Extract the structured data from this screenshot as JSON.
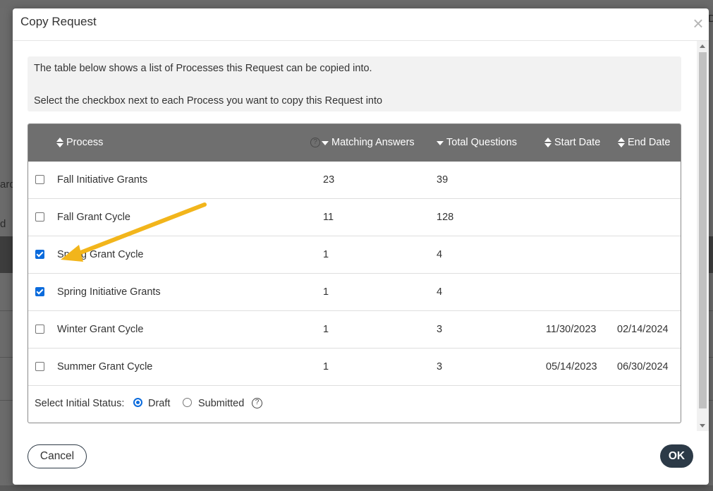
{
  "background": {
    "fragment_1": "ard",
    "fragment_2": "d",
    "fragment_3": "De"
  },
  "dialog": {
    "title": "Copy Request",
    "close_glyph": "×",
    "info_line1": "The table below shows a list of Processes this Request can be copied into.",
    "info_line2": "Select the checkbox next to each Process you want to copy this Request into"
  },
  "table": {
    "headers": {
      "process": "Process",
      "matching_answers": "Matching Answers",
      "total_questions": "Total Questions",
      "start_date": "Start Date",
      "end_date": "End Date"
    },
    "help_glyph": "?",
    "rows": [
      {
        "checked": false,
        "process": "Fall Initiative Grants",
        "matching": "23",
        "total": "39",
        "start": "",
        "end": ""
      },
      {
        "checked": false,
        "process": "Fall Grant Cycle",
        "matching": "11",
        "total": "128",
        "start": "",
        "end": ""
      },
      {
        "checked": true,
        "process": "Spring Grant Cycle",
        "matching": "1",
        "total": "4",
        "start": "",
        "end": ""
      },
      {
        "checked": true,
        "process": "Spring Initiative Grants",
        "matching": "1",
        "total": "4",
        "start": "",
        "end": ""
      },
      {
        "checked": false,
        "process": "Winter Grant Cycle",
        "matching": "1",
        "total": "3",
        "start": "11/30/2023",
        "end": "02/14/2024"
      },
      {
        "checked": false,
        "process": "Summer Grant Cycle",
        "matching": "1",
        "total": "3",
        "start": "05/14/2023",
        "end": "06/30/2024"
      }
    ]
  },
  "status": {
    "label": "Select Initial Status:",
    "options": [
      "Draft",
      "Submitted"
    ],
    "selected": "Draft"
  },
  "footer": {
    "cancel_label": "Cancel",
    "ok_label": "OK"
  },
  "colors": {
    "header_bg": "#6f6f6f",
    "checkbox_accent": "#0b6bdc",
    "primary_button": "#2c3a47",
    "annotation_arrow": "#f2b51b"
  }
}
